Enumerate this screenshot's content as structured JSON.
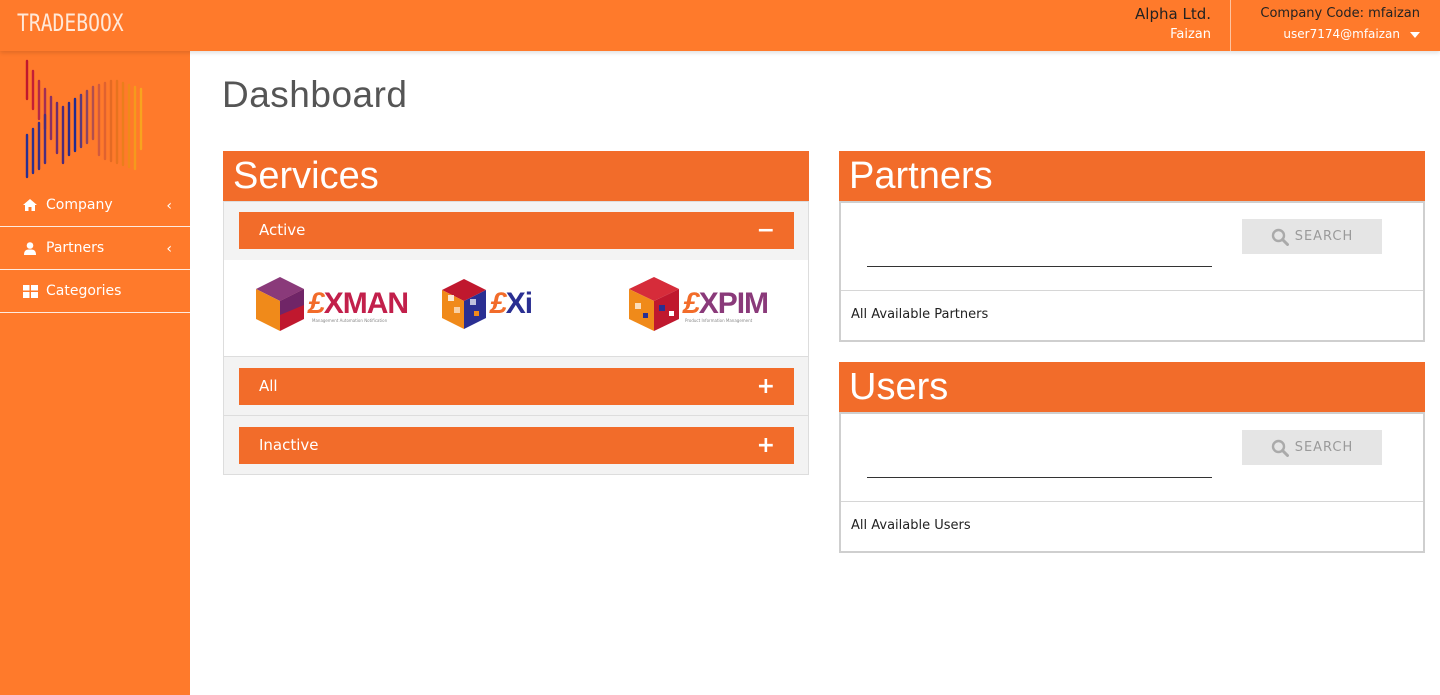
{
  "header": {
    "brand": "TRADEBOOX",
    "org_name": "Alpha Ltd.",
    "user_name": "Faizan",
    "company_code": "Company Code: mfaizan",
    "user_email": "user7174@mfaizan"
  },
  "sidebar": {
    "items": [
      {
        "label": "Company",
        "icon": "home-icon",
        "has_chevron": true
      },
      {
        "label": "Partners",
        "icon": "user-icon",
        "has_chevron": true
      },
      {
        "label": "Categories",
        "icon": "grid-icon",
        "has_chevron": false
      }
    ],
    "chevron": "‹"
  },
  "page": {
    "title": "Dashboard"
  },
  "services": {
    "title": "Services",
    "sections": [
      {
        "label": "Active",
        "state": "expanded",
        "symbol": "−"
      },
      {
        "label": "All",
        "state": "collapsed",
        "symbol": "+"
      },
      {
        "label": "Inactive",
        "state": "collapsed",
        "symbol": "+"
      }
    ],
    "products": [
      {
        "name": "XMAN",
        "tagline": "Management Automation Notification"
      },
      {
        "name": "Xi",
        "tagline": ""
      },
      {
        "name": "XPIM",
        "tagline": "Product Information Management"
      }
    ]
  },
  "partners": {
    "title": "Partners",
    "search_label": "SEARCH",
    "list_label": "All Available Partners"
  },
  "users": {
    "title": "Users",
    "search_label": "SEARCH",
    "list_label": "All Available Users"
  },
  "colors": {
    "brand_orange": "#ff7a2b",
    "panel_orange": "#f26c2a",
    "search_bg": "#e5e5e5"
  }
}
